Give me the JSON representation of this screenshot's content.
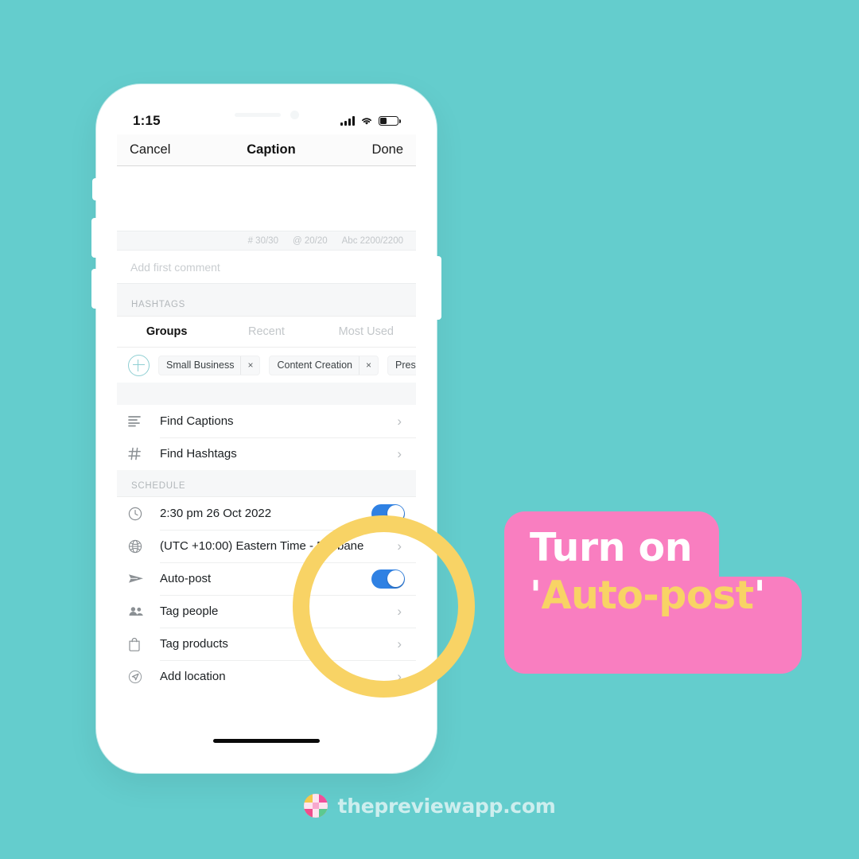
{
  "background_color": "#64cdcd",
  "phone": {
    "status_bar": {
      "time": "1:15",
      "signal_icon": "signal-bars-icon",
      "wifi_icon": "wifi-icon",
      "battery_icon": "battery-low-icon"
    },
    "nav_bar": {
      "cancel_label": "Cancel",
      "title": "Caption",
      "done_label": "Done"
    },
    "caption": {
      "text": "",
      "counters": [
        "# 30/30",
        "@ 20/20",
        "Abc 2200/2200"
      ],
      "first_comment_placeholder": "Add first comment"
    },
    "hashtags": {
      "section_label": "HASHTAGS",
      "tabs": [
        {
          "label": "Groups",
          "active": true
        },
        {
          "label": "Recent",
          "active": false
        },
        {
          "label": "Most Used",
          "active": false
        }
      ],
      "add_icon": "plus-circle-icon",
      "chips": [
        {
          "label": "Small Business",
          "remove": "×"
        },
        {
          "label": "Content Creation",
          "remove": "×"
        },
        {
          "label": "Prese",
          "remove": "×"
        }
      ]
    },
    "find_rows": [
      {
        "icon": "align-left-icon",
        "label": "Find Captions",
        "chevron": "›"
      },
      {
        "icon": "hash-icon",
        "label": "Find Hashtags",
        "chevron": "›"
      }
    ],
    "schedule": {
      "section_label": "SCHEDULE",
      "rows": [
        {
          "icon": "clock-icon",
          "label": "2:30 pm  26 Oct 2022",
          "control": "toggle",
          "on": true
        },
        {
          "icon": "globe-icon",
          "label": "(UTC +10:00) Eastern Time - Brisbane",
          "control": "chevron",
          "chevron": "›"
        },
        {
          "icon": "paper-plane-icon",
          "label": "Auto-post",
          "control": "toggle",
          "on": true
        },
        {
          "icon": "people-icon",
          "label": "Tag people",
          "control": "chevron",
          "chevron": "›"
        },
        {
          "icon": "shopping-bag-icon",
          "label": "Tag products",
          "control": "chevron",
          "chevron": "›"
        },
        {
          "icon": "location-arrow-icon",
          "label": "Add location",
          "control": "chevron",
          "chevron": "›"
        }
      ]
    },
    "toggle_on_color": "#2f81e3"
  },
  "highlight": {
    "shape": "circle-ring",
    "color": "#f8d365"
  },
  "callout": {
    "background_color": "#f97ec0",
    "line1": "Turn on",
    "line2_quote_open": "'",
    "line2_highlight": "Auto-post",
    "line2_quote_close": "'",
    "highlight_color": "#f8d365",
    "text_color": "#ffffff"
  },
  "footer": {
    "logo_icon": "preview-app-logo-icon",
    "wordmark": "thepreviewapp.com",
    "wordmark_color": "#cdeeee"
  }
}
